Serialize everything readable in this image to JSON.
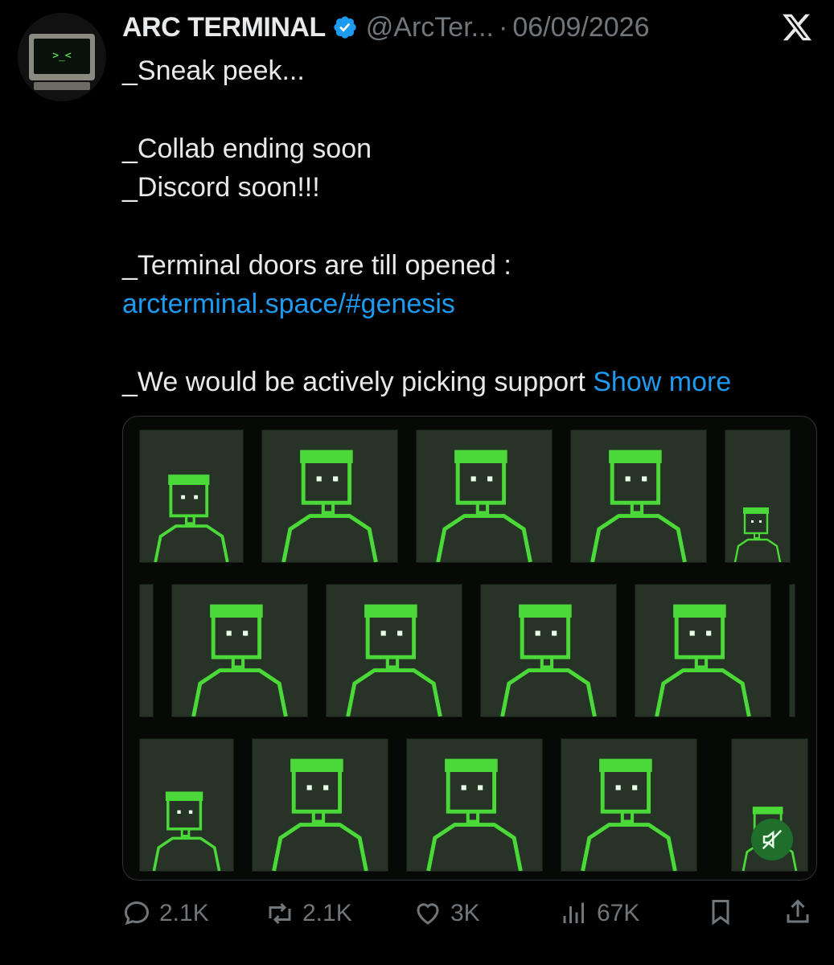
{
  "author": {
    "name": "ARC TERMINAL",
    "handle": "@ArcTer...",
    "separator": "·",
    "date": "06/09/2026",
    "avatar_text": ">_<"
  },
  "post": {
    "lines": [
      "_Sneak peek...",
      "",
      "_Collab ending soon",
      "_Discord soon!!!",
      "",
      "_Terminal doors are till opened :"
    ],
    "link": "arcterminal.space/#genesis",
    "last_line": "_We would be actively picking support",
    "show_more": "Show more"
  },
  "media": {
    "type": "video",
    "description_icon": "pixel-art-characters-grid",
    "muted": true
  },
  "actions": {
    "replies": "2.1K",
    "reposts": "2.1K",
    "likes": "3K",
    "views": "67K"
  },
  "colors": {
    "background": "#000000",
    "text": "#e7e9ea",
    "muted_text": "#71767b",
    "link": "#1d9bf0",
    "pixel_green": "#4bd93a",
    "tile_bg": "#263326"
  }
}
